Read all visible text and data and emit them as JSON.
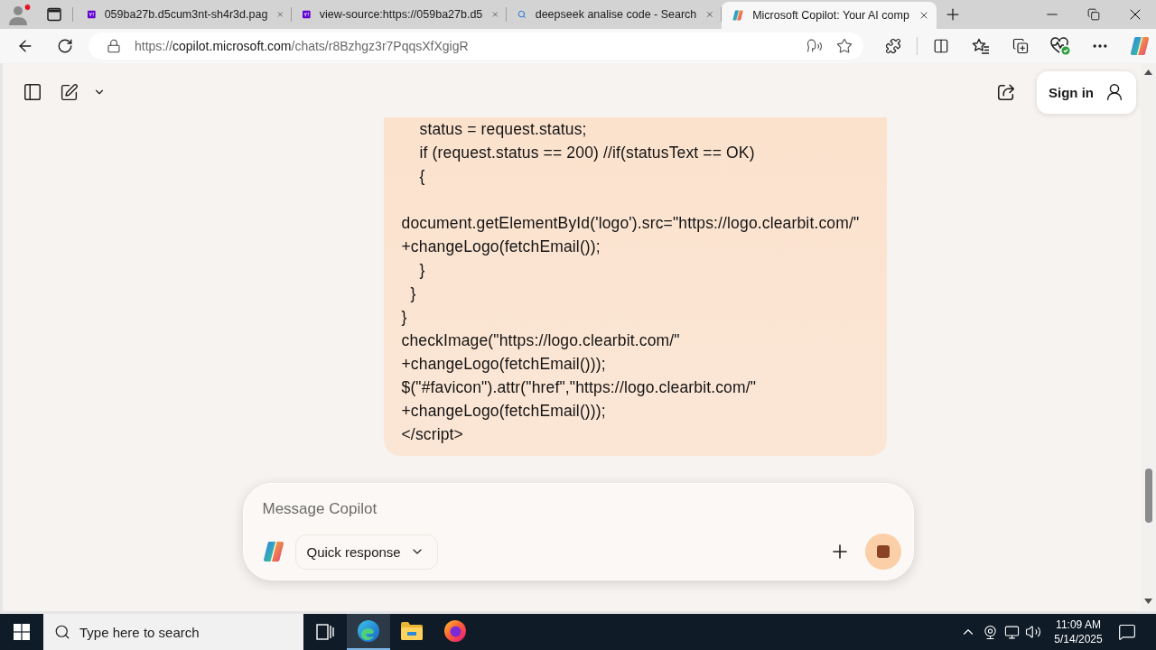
{
  "browser": {
    "tabs": [
      {
        "title": "059ba27b.d5cum3nt-sh4r3d.pag",
        "kind": "yahoo",
        "selected": false
      },
      {
        "title": "view-source:https://059ba27b.d5",
        "kind": "yahoo",
        "selected": false
      },
      {
        "title": "deepseek analise code - Search",
        "kind": "search",
        "selected": false
      },
      {
        "title": "Microsoft Copilot: Your AI comp",
        "kind": "copilot",
        "selected": true
      }
    ],
    "address": {
      "scheme": "https://",
      "host": "copilot.microsoft.com",
      "path": "/chats/r8Bzhgz3r7PqqsXfXgigR"
    }
  },
  "page": {
    "header": {
      "sign_in": "Sign in"
    },
    "message": {
      "paragraphs": [
        {
          "lines": [
            "    status = request.status;",
            "    if (request.status == 200) //if(statusText == OK)",
            "    {"
          ]
        },
        {
          "lines": [
            "document.getElementById('logo').src=\"https://logo.clearbit.com/\"",
            "+changeLogo(fetchEmail());",
            "    }",
            "  }",
            "}",
            "checkImage(\"https://logo.clearbit.com/\"",
            "+changeLogo(fetchEmail()));",
            "$(\"#favicon\").attr(\"href\",\"https://logo.clearbit.com/\"",
            "+changeLogo(fetchEmail()));",
            "</script>"
          ]
        }
      ]
    },
    "composer": {
      "placeholder": "Message Copilot",
      "mode": "Quick response"
    }
  },
  "taskbar": {
    "search_placeholder": "Type here to search",
    "apps": [
      {
        "kind": "edge",
        "selected": true
      },
      {
        "kind": "explorer",
        "selected": false
      },
      {
        "kind": "firefox",
        "selected": false
      }
    ],
    "time": "11:09 AM",
    "date": "5/14/2025"
  }
}
